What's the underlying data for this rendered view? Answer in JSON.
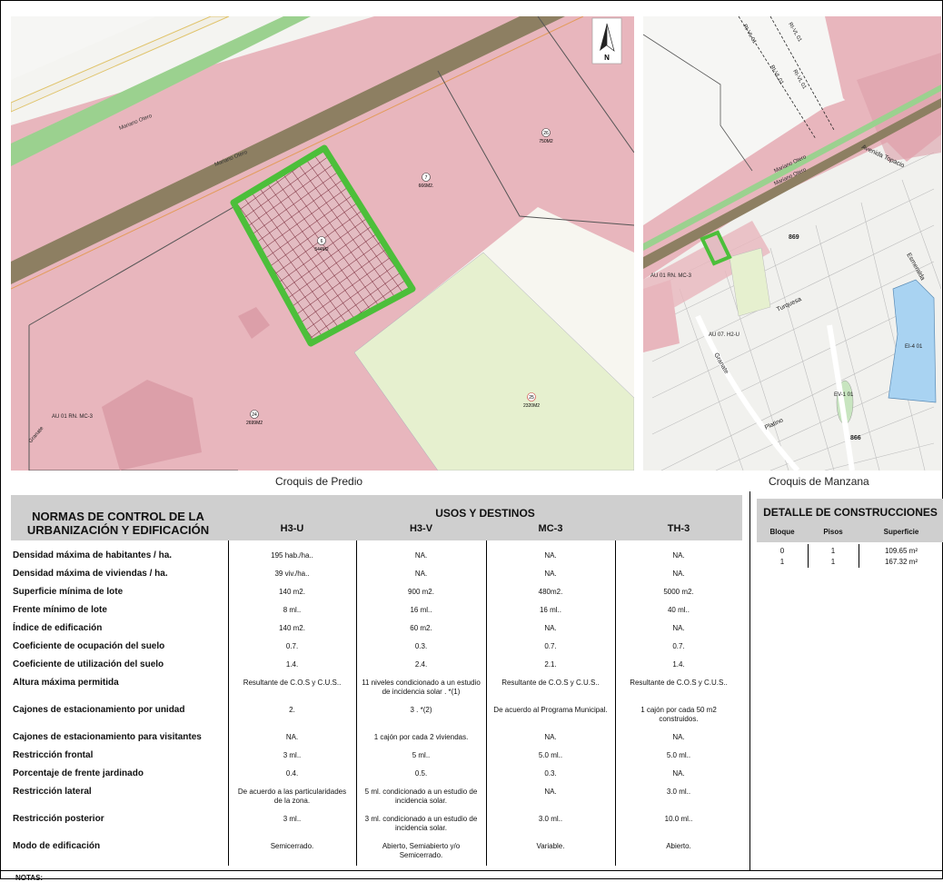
{
  "maps": {
    "predio": {
      "caption": "Croquis de Predio",
      "street_labels": [
        "Mariano Otero",
        "Mariano Otero",
        "AU 01 RN. MC-3",
        "Granate"
      ],
      "lots": [
        {
          "num": "6",
          "area": "544M2"
        },
        {
          "num": "7",
          "area": "666M2."
        },
        {
          "num": "26",
          "area": "750M2"
        },
        {
          "num": "24",
          "area": "2699M2"
        },
        {
          "num": "25",
          "area": "2320M2"
        }
      ],
      "north_label": "N"
    },
    "manzana": {
      "caption": "Croquis de Manzana",
      "labels": [
        "RI-VL 01",
        "RI-VL 01",
        "RI-VL 01",
        "RI-VL 01",
        "Mariano Otero",
        "Mariano Otero",
        "Avenida Topacio",
        "869",
        "Esmeralda",
        "AU 01 RN. MC-3",
        "Turquesa",
        "AU 07. H2-U",
        "Granate",
        "EI-4 01",
        "EV-1 01",
        "Platino",
        "866"
      ]
    }
  },
  "normas": {
    "title_line1": "NORMAS DE CONTROL DE LA",
    "title_line2": "URBANIZACIÓN Y EDIFICACIÓN",
    "usos_title": "USOS Y DESTINOS",
    "columns": [
      "H3-U",
      "H3-V",
      "MC-3",
      "TH-3"
    ],
    "rows": [
      {
        "label": "Densidad máxima de habitantes / ha.",
        "values": [
          "195 hab./ha..",
          "NA.",
          "NA.",
          "NA."
        ]
      },
      {
        "label": "Densidad máxima de viviendas / ha.",
        "values": [
          "39 viv./ha..",
          "NA.",
          "NA.",
          "NA."
        ]
      },
      {
        "label": "Superficie mínima de lote",
        "values": [
          "140 m2.",
          "900 m2.",
          "480m2.",
          "5000 m2."
        ]
      },
      {
        "label": "Frente mínimo de lote",
        "values": [
          "8 ml..",
          "16 ml..",
          "16 ml..",
          "40 ml.."
        ]
      },
      {
        "label": "Índice de edificación",
        "values": [
          "140 m2.",
          "60 m2.",
          "NA.",
          "NA."
        ]
      },
      {
        "label": "Coeficiente de ocupación del suelo",
        "values": [
          "0.7.",
          "0.3.",
          "0.7.",
          "0.7."
        ]
      },
      {
        "label": "Coeficiente de utilización del suelo",
        "values": [
          "1.4.",
          "2.4.",
          "2.1.",
          "1.4."
        ]
      },
      {
        "label": "Altura máxima permitida",
        "values": [
          "Resultante de C.O.S y C.U.S..",
          "11 niveles condicionado a un estudio de incidencia solar . *(1)",
          "Resultante de C.O.S y C.U.S..",
          "Resultante de C.O.S y C.U.S.."
        ]
      },
      {
        "label": "Cajones de estacionamiento por unidad",
        "values": [
          "2.",
          "3 . *(2)",
          "De acuerdo al Programa Municipal.",
          "1 cajón por cada 50 m2 construidos."
        ]
      },
      {
        "label": "Cajones de estacionamiento para visitantes",
        "values": [
          "NA.",
          "1 cajón por cada 2 viviendas.",
          "NA.",
          "NA."
        ]
      },
      {
        "label": "Restricción frontal",
        "values": [
          "3 ml..",
          "5 ml..",
          "5.0 ml..",
          "5.0 ml.."
        ]
      },
      {
        "label": "Porcentaje de frente jardinado",
        "values": [
          "0.4.",
          "0.5.",
          "0.3.",
          "NA."
        ]
      },
      {
        "label": "Restricción lateral",
        "values": [
          "De acuerdo a las particularidades de la zona.",
          "5 ml. condicionado a un estudio de incidencia solar.",
          "NA.",
          "3.0 ml.."
        ]
      },
      {
        "label": "Restricción posterior",
        "values": [
          "3 ml..",
          "3 ml. condicionado a un estudio de incidencia solar.",
          "3.0 ml..",
          "10.0 ml.."
        ]
      },
      {
        "label": "Modo de edificación",
        "values": [
          "Semicerrado.",
          "Abierto, Semiabierto y/o Semicerrado.",
          "Variable.",
          "Abierto."
        ]
      }
    ]
  },
  "detalle": {
    "title": "DETALLE DE CONSTRUCCIONES",
    "columns": [
      "Bloque",
      "Pisos",
      "Superficie"
    ],
    "rows": [
      [
        "0",
        "1",
        "109.65 m²"
      ],
      [
        "1",
        "1",
        "167.32 m²"
      ]
    ]
  },
  "notes_label": "NOTAS:",
  "colors": {
    "zone_pink": "#e8b6bd",
    "zone_dark_pink": "#d99aa4",
    "lot_outline": "#4cbf3a",
    "green_area": "#e6f0cf",
    "header_gray": "#cfcfcf",
    "road_brown": "#8d7f62",
    "blue_zone": "#a9d3f2"
  }
}
